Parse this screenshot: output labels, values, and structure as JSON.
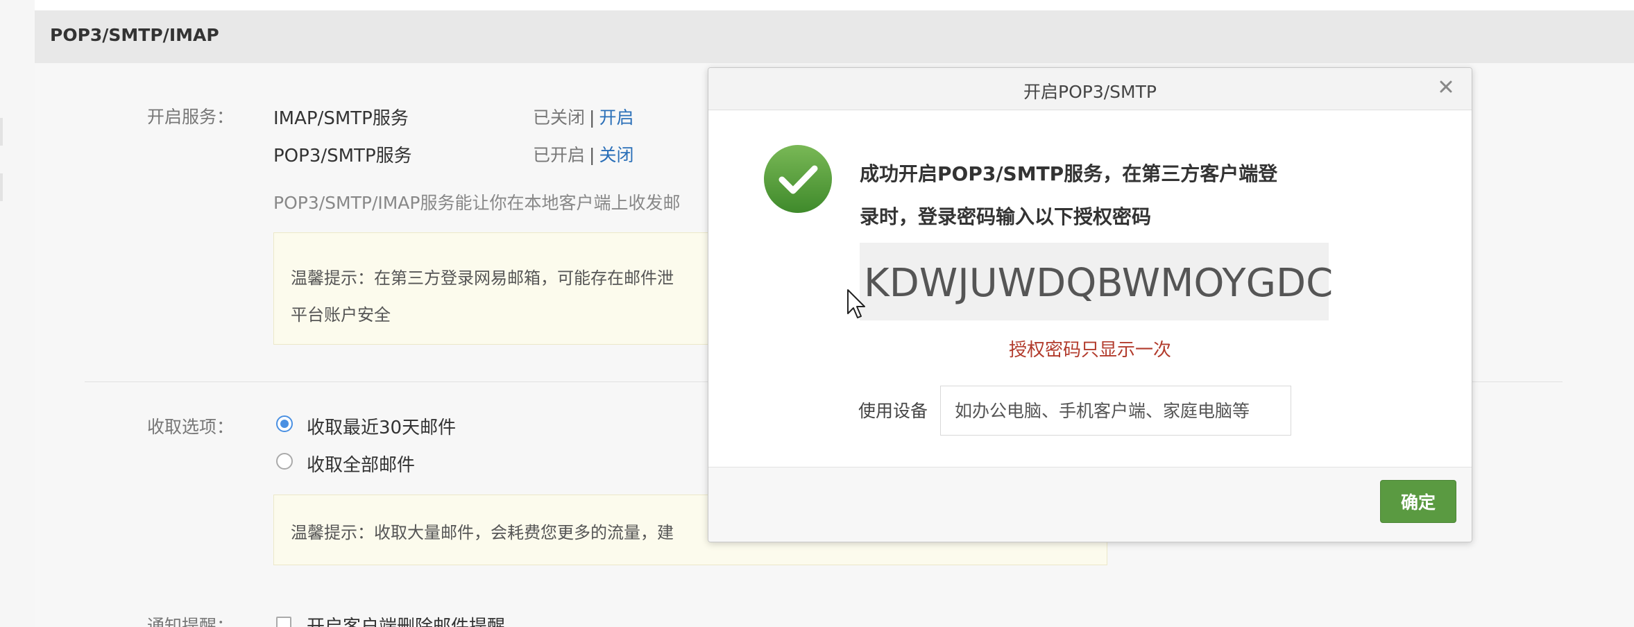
{
  "section": {
    "title": "POP3/SMTP/IMAP"
  },
  "services": {
    "label": "开启服务：",
    "items": [
      {
        "name": "IMAP/SMTP服务",
        "status": "已关闭",
        "action": "开启"
      },
      {
        "name": "POP3/SMTP服务",
        "status": "已开启",
        "action": "关闭"
      }
    ],
    "separator": "|",
    "description": "POP3/SMTP/IMAP服务能让你在本地客户端上收发邮",
    "tip_line1": "温馨提示：在第三方登录网易邮箱，可能存在邮件泄",
    "tip_line2": "平台账户安全"
  },
  "fetch": {
    "label": "收取选项：",
    "options": [
      {
        "label": "收取最近30天邮件",
        "checked": true
      },
      {
        "label": "收取全部邮件",
        "checked": false
      }
    ],
    "tip": "温馨提示：收取大量邮件，会耗费您更多的流量，建"
  },
  "notify": {
    "label": "通知提醒：",
    "option": "开启客户端删除邮件提醒"
  },
  "modal": {
    "title": "开启POP3/SMTP",
    "success_line1": "成功开启POP3/SMTP服务，在第三方客户端登",
    "success_line2": "录时，登录密码输入以下授权密码",
    "auth_code": "KDWJUWDQBWMOYGDC",
    "once_note": "授权密码只显示一次",
    "device_label": "使用设备",
    "device_placeholder": "如办公电脑、手机客户端、家庭电脑等",
    "confirm_label": "确定"
  },
  "colors": {
    "link": "#2a6fb8",
    "success_green": "#5a9a41",
    "warning_red": "#b23b2c",
    "tip_background": "#fcfbed"
  },
  "icons": {
    "success": "check-circle-icon",
    "close": "close-icon",
    "cursor": "mouse-pointer-icon"
  }
}
